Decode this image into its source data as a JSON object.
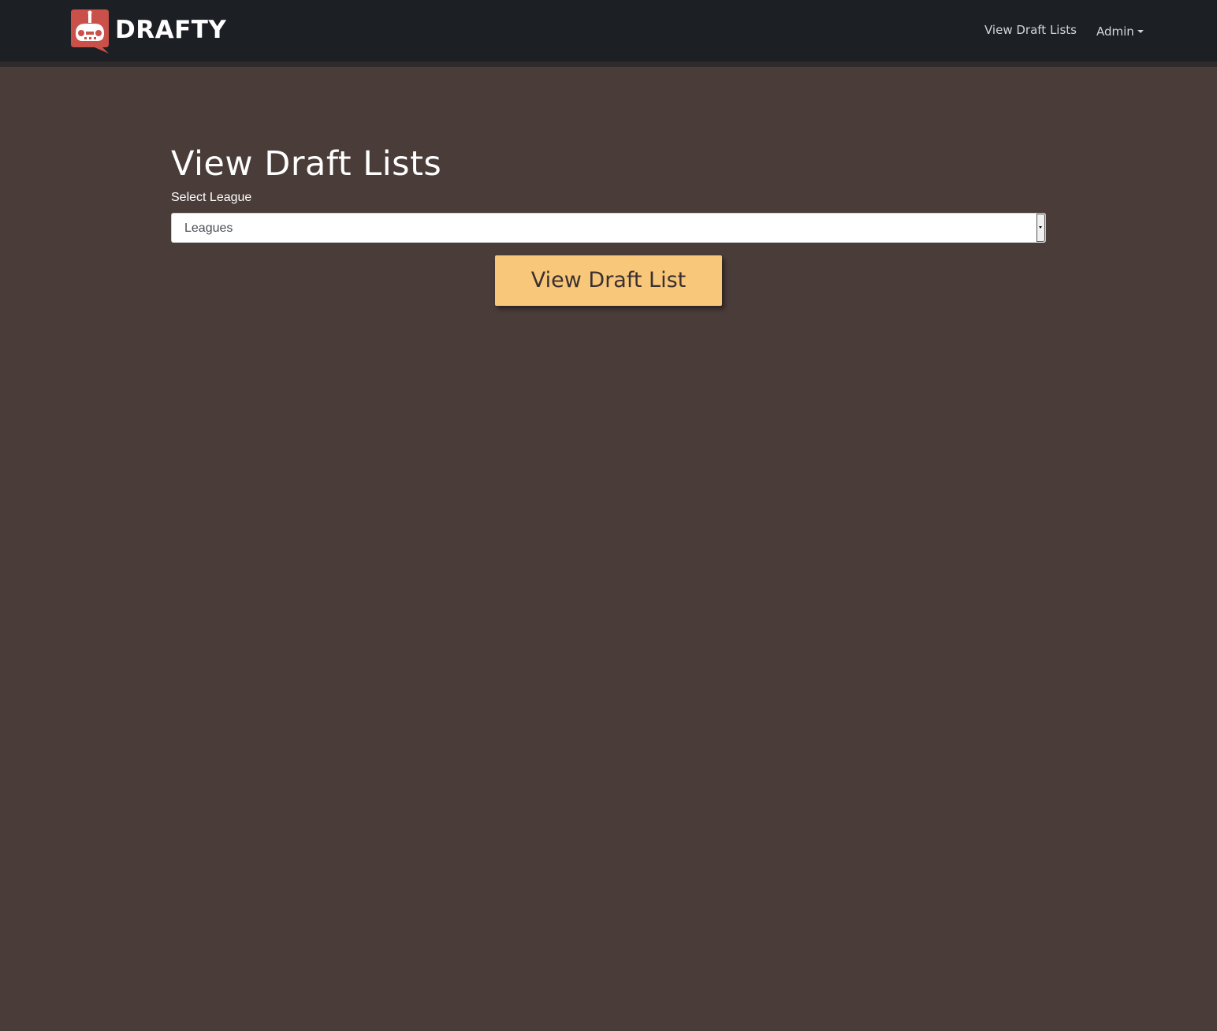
{
  "navbar": {
    "brand_name": "DRAFTY",
    "logo_icon": "controller-chat-logo-icon",
    "links": {
      "view_draft_lists": "View Draft Lists",
      "admin": "Admin"
    }
  },
  "main": {
    "title": "View Draft Lists",
    "select_label": "Select League",
    "select_value": "Leagues",
    "submit_button": "View Draft List"
  },
  "colors": {
    "navbar_bg": "#1c1f24",
    "page_bg": "#4a3c39",
    "button_bg": "#f8c77a",
    "logo_red": "#c9514a"
  }
}
